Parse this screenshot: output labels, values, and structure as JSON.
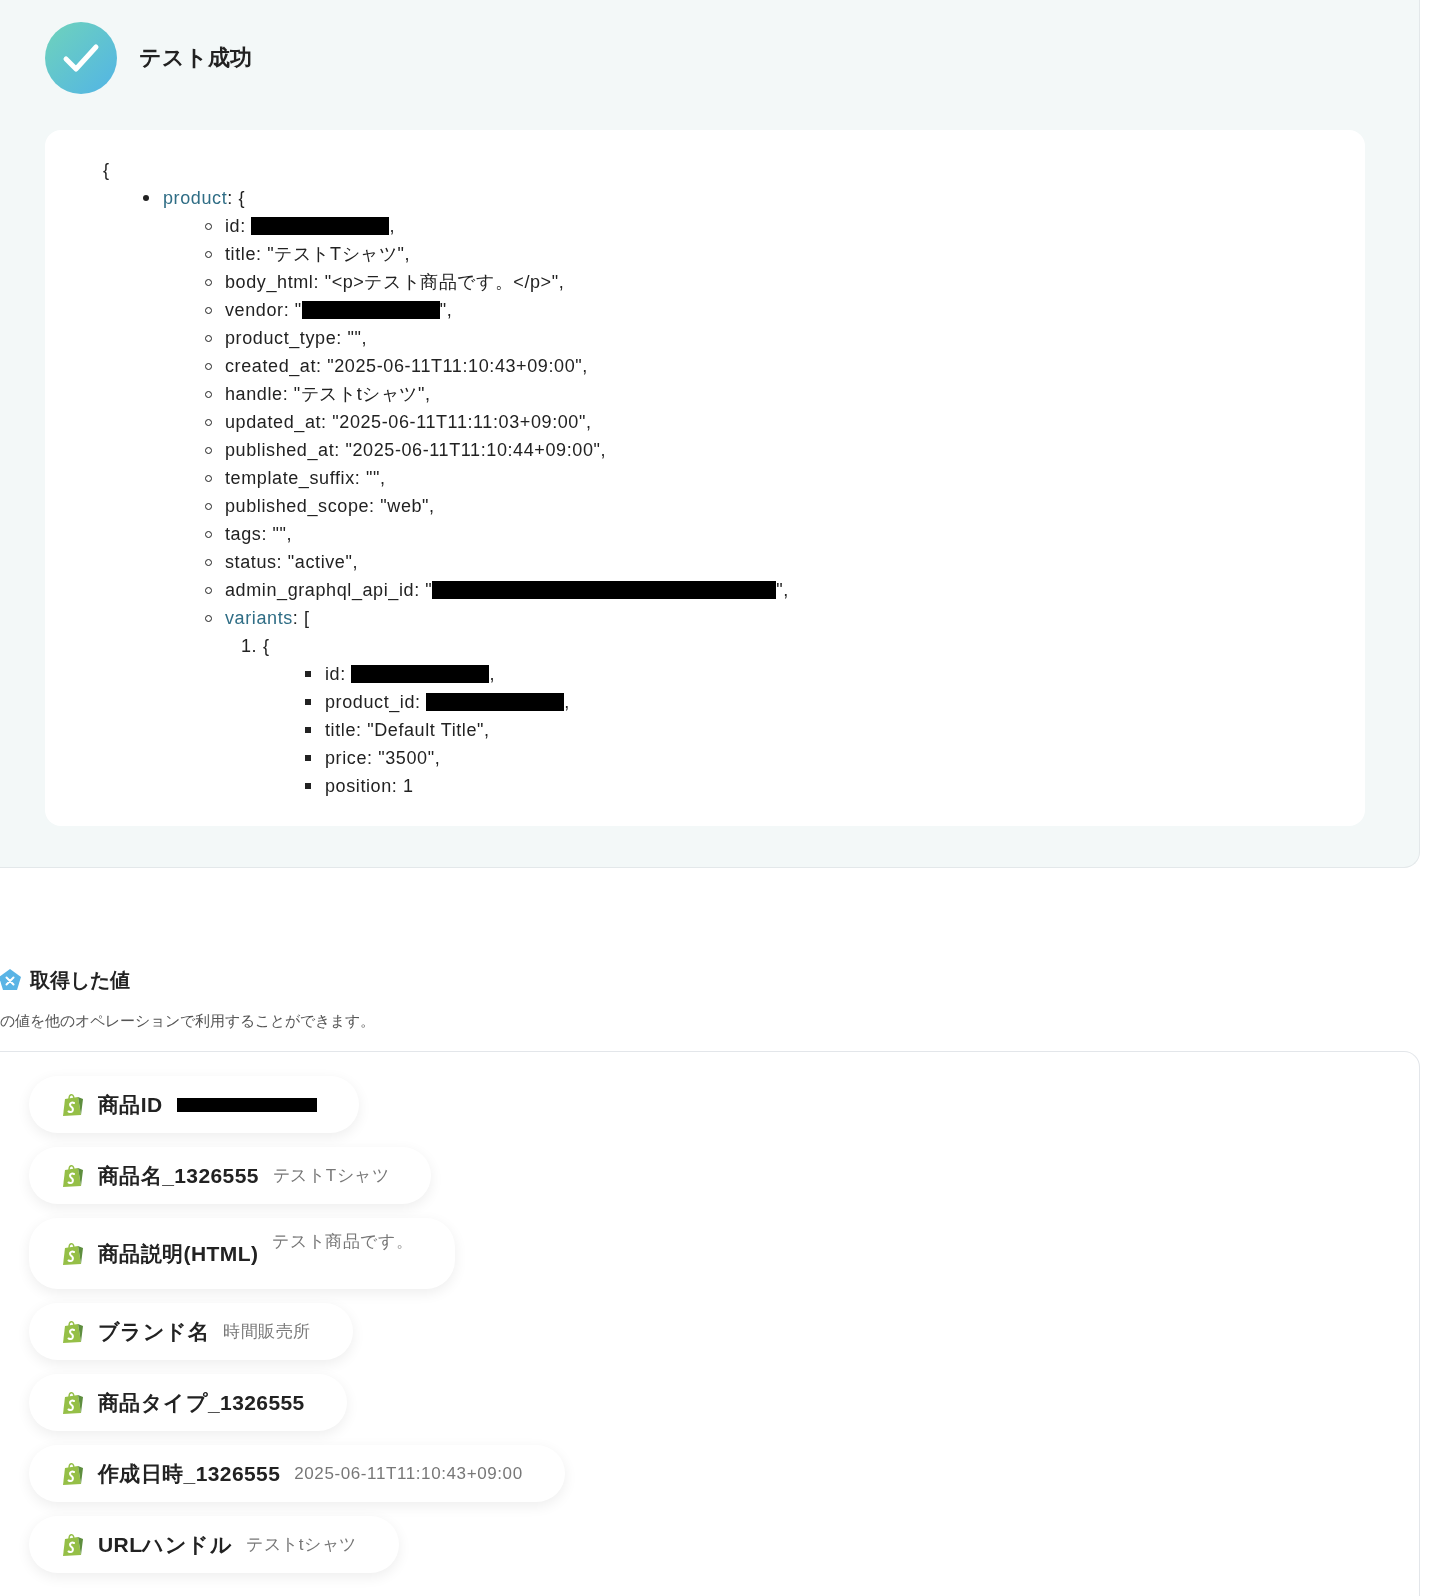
{
  "result": {
    "title": "テスト成功",
    "success": true
  },
  "code": {
    "open": "{",
    "items": [
      {
        "key": "product",
        "text": ": {",
        "items": [
          {
            "text": "id: ",
            "redacted": true,
            "tail": ","
          },
          {
            "text": "title: \"テストTシャツ\","
          },
          {
            "text": "body_html: \"<p>テスト商品です。</p>\","
          },
          {
            "text": "vendor: \"",
            "redacted": true,
            "tail": "\","
          },
          {
            "text": "product_type: \"\","
          },
          {
            "text": "created_at: \"2025-06-11T11:10:43+09:00\","
          },
          {
            "text": "handle: \"テストtシャツ\","
          },
          {
            "text": "updated_at: \"2025-06-11T11:11:03+09:00\","
          },
          {
            "text": "published_at: \"2025-06-11T11:10:44+09:00\","
          },
          {
            "text": "template_suffix: \"\","
          },
          {
            "text": "published_scope: \"web\","
          },
          {
            "text": "tags: \"\","
          },
          {
            "text": "status: \"active\","
          },
          {
            "text": "admin_graphql_api_id: \"",
            "redacted": true,
            "wide": true,
            "tail": "\","
          },
          {
            "key": "variants",
            "text": ": [",
            "items": [
              {
                "number": "1.",
                "text": "{",
                "items": [
                  {
                    "text": "id: ",
                    "redacted": true,
                    "tail": ","
                  },
                  {
                    "text": "product_id: ",
                    "redacted": true,
                    "tail": ","
                  },
                  {
                    "text": "title: \"Default Title\","
                  },
                  {
                    "text": "price: \"3500\","
                  },
                  {
                    "text": "position: 1"
                  }
                ]
              }
            ]
          }
        ]
      }
    ]
  },
  "values": {
    "title": "取得した値",
    "description": "の値を他のオペレーションで利用することができます。",
    "items": [
      {
        "label": "商品ID",
        "redacted": true
      },
      {
        "label": "商品名_1326555",
        "value": "テストTシャツ"
      },
      {
        "label": "商品説明(HTML)",
        "value": "テスト商品です。",
        "kind": "tall"
      },
      {
        "label": "ブランド名",
        "value": "時間販売所"
      },
      {
        "label": "商品タイプ_1326555"
      },
      {
        "label": "作成日時_1326555",
        "value": "2025-06-11T11:10:43+09:00"
      },
      {
        "label": "URLハンドル",
        "value": "テストtシャツ"
      }
    ]
  }
}
